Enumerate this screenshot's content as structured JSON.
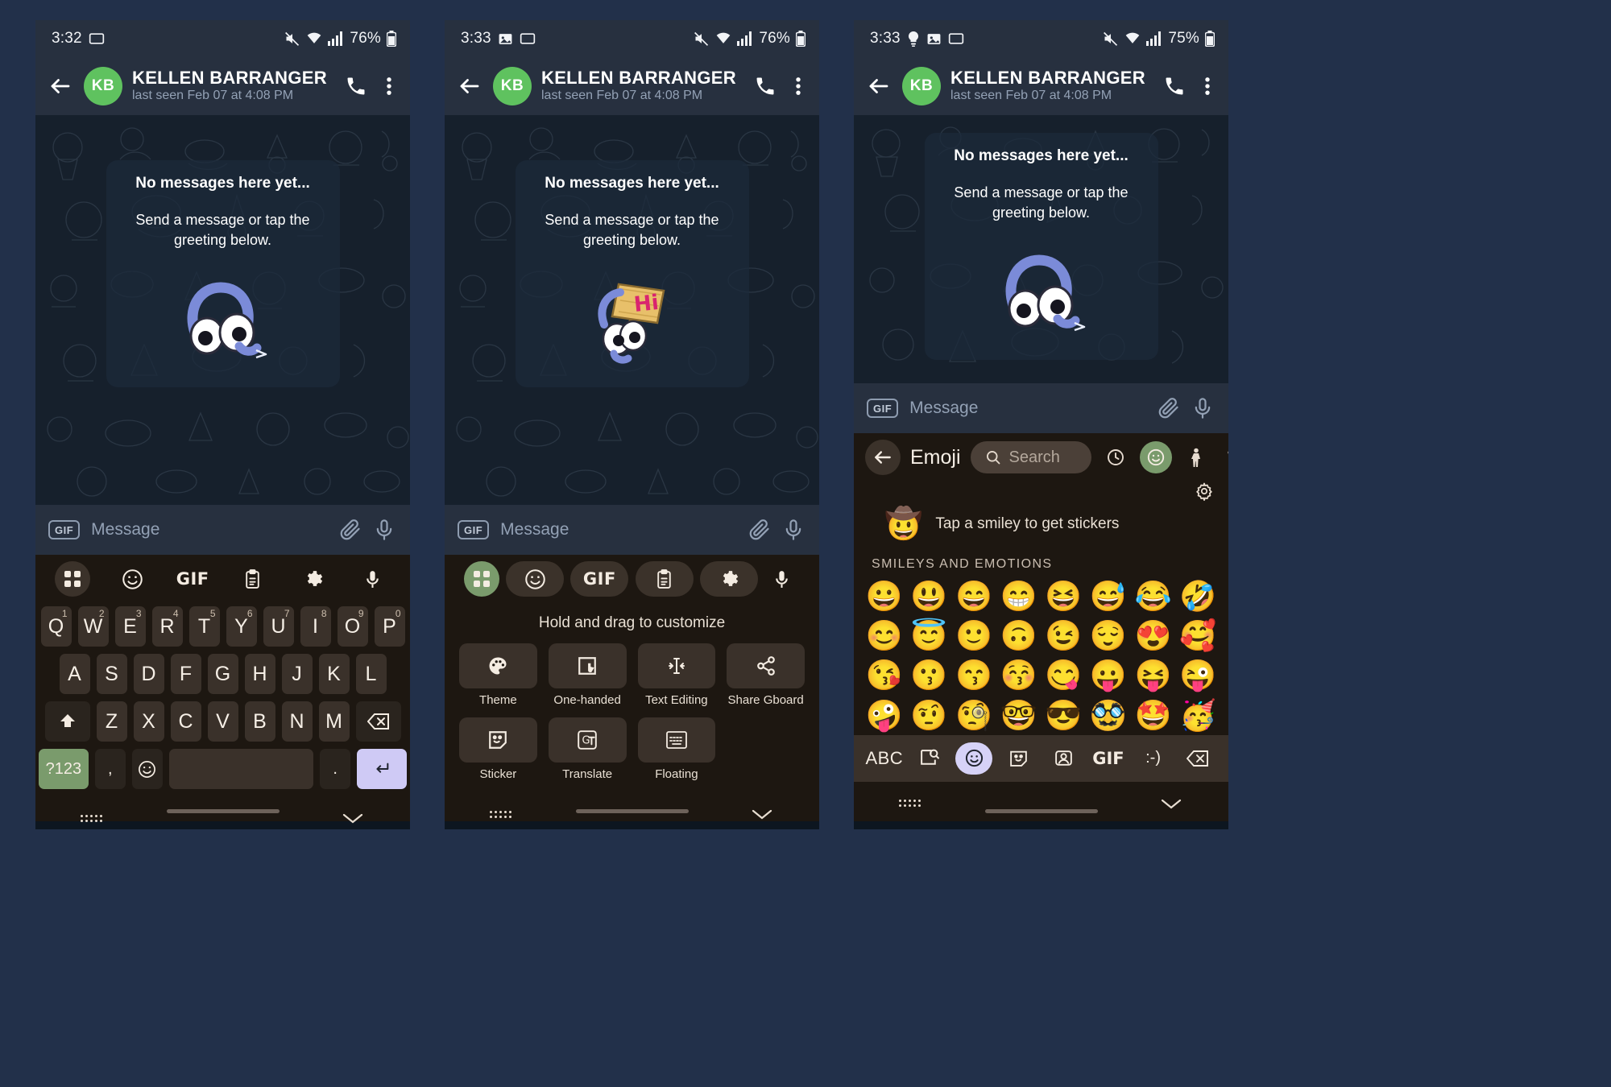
{
  "panels": [
    {
      "id": "panel-keyboard",
      "status": {
        "time": "3:32",
        "battery": "76%",
        "icons_left": [
          "cast-icon"
        ],
        "icons_right": [
          "mute-icon",
          "wifi-icon",
          "signal-icon",
          "battery-icon"
        ]
      },
      "header": {
        "avatar_initials": "KB",
        "name": "KELLEN BARRANGER",
        "subtitle": "last seen Feb 07 at 4:08 PM"
      },
      "chat": {
        "empty_title": "No messages here yet...",
        "empty_sub": "Send a message or tap the greeting below.",
        "sticker": "duck-peeking-sticker"
      },
      "input": {
        "gif_label": "GIF",
        "placeholder": "Message",
        "attach": "paperclip-icon",
        "voice": "microphone-icon"
      },
      "keyboard": {
        "toolbar": [
          {
            "name": "grid-icon",
            "active": true,
            "green": false
          },
          {
            "name": "emoji-icon",
            "active": false,
            "green": false
          },
          {
            "name": "gif-icon",
            "label": "GIF",
            "active": false,
            "green": false
          },
          {
            "name": "clipboard-icon",
            "active": false,
            "green": false
          },
          {
            "name": "gear-icon",
            "active": false,
            "green": false
          },
          {
            "name": "microphone-icon",
            "active": false,
            "green": false
          }
        ],
        "row1": [
          {
            "k": "Q",
            "n": "1"
          },
          {
            "k": "W",
            "n": "2"
          },
          {
            "k": "E",
            "n": "3"
          },
          {
            "k": "R",
            "n": "4"
          },
          {
            "k": "T",
            "n": "5"
          },
          {
            "k": "Y",
            "n": "6"
          },
          {
            "k": "U",
            "n": "7"
          },
          {
            "k": "I",
            "n": "8"
          },
          {
            "k": "O",
            "n": "9"
          },
          {
            "k": "P",
            "n": "0"
          }
        ],
        "row2": [
          "A",
          "S",
          "D",
          "F",
          "G",
          "H",
          "J",
          "K",
          "L"
        ],
        "row3": [
          "Z",
          "X",
          "C",
          "V",
          "B",
          "N",
          "M"
        ],
        "shift_key": "shift-icon",
        "backspace_key": "backspace-icon",
        "sym_key": "?123",
        "comma_key": ",",
        "emoji_key": "emoji-icon",
        "space_key": "",
        "period_key": ".",
        "enter_key": "enter-icon"
      },
      "navbar": {
        "left": "keyboard-dots-icon",
        "right": "chevron-down-icon"
      }
    },
    {
      "id": "panel-customize",
      "status": {
        "time": "3:33",
        "battery": "76%",
        "icons_left": [
          "image-icon",
          "cast-icon"
        ],
        "icons_right": [
          "mute-icon",
          "wifi-icon",
          "signal-icon",
          "battery-icon"
        ]
      },
      "header": {
        "avatar_initials": "KB",
        "name": "KELLEN BARRANGER",
        "subtitle": "last seen Feb 07 at 4:08 PM"
      },
      "chat": {
        "empty_title": "No messages here yet...",
        "empty_sub": "Send a message or tap the greeting below.",
        "sticker": "duck-hi-sign-sticker"
      },
      "input": {
        "gif_label": "GIF",
        "placeholder": "Message",
        "attach": "paperclip-icon",
        "voice": "microphone-icon"
      },
      "keyboard": {
        "toolbar": [
          {
            "name": "grid-icon",
            "active": false,
            "green": true
          },
          {
            "name": "emoji-icon",
            "active": true,
            "green": false
          },
          {
            "name": "gif-icon",
            "label": "GIF",
            "active": true,
            "green": false
          },
          {
            "name": "clipboard-icon",
            "active": true,
            "green": false
          },
          {
            "name": "gear-icon",
            "active": true,
            "green": false
          },
          {
            "name": "microphone-icon",
            "active": false,
            "green": false
          }
        ]
      },
      "customize": {
        "hint": "Hold and drag to customize",
        "items": [
          {
            "label": "Theme",
            "icon": "palette-icon"
          },
          {
            "label": "One-handed",
            "icon": "one-handed-icon"
          },
          {
            "label": "Text Editing",
            "icon": "text-editing-icon"
          },
          {
            "label": "Share Gboard",
            "icon": "share-icon"
          },
          {
            "label": "Sticker",
            "icon": "sticker-icon"
          },
          {
            "label": "Translate",
            "icon": "translate-icon"
          },
          {
            "label": "Floating",
            "icon": "floating-keyboard-icon"
          }
        ]
      },
      "navbar": {
        "left": "keyboard-dots-icon",
        "right": "chevron-down-icon"
      }
    },
    {
      "id": "panel-emoji",
      "status": {
        "time": "3:33",
        "battery": "75%",
        "icons_left": [
          "bulb-icon",
          "image-icon",
          "cast-icon"
        ],
        "icons_right": [
          "mute-icon",
          "wifi-icon",
          "signal-icon",
          "battery-icon"
        ]
      },
      "header": {
        "avatar_initials": "KB",
        "name": "KELLEN BARRANGER",
        "subtitle": "last seen Feb 07 at 4:08 PM"
      },
      "chat": {
        "empty_title": "No messages here yet...",
        "empty_sub": "Send a message or tap the greeting below.",
        "sticker": "duck-peeking-sticker"
      },
      "input": {
        "gif_label": "GIF",
        "placeholder": "Message",
        "attach": "paperclip-icon",
        "voice": "microphone-icon"
      },
      "emoji": {
        "back": "back-arrow-icon",
        "title": "Emoji",
        "search_placeholder": "Search",
        "categories": [
          "recent-clock-icon",
          "smiley-icon",
          "person-icon",
          "animal-icon",
          "food-icon"
        ],
        "selected_category_index": 1,
        "settings_icon": "gear-icon",
        "sticker_hint": "Tap a smiley to get stickers",
        "sticker_hint_face": "🤠",
        "section_header": "SMILEYS AND EMOTIONS",
        "grid": [
          "😀",
          "😃",
          "😄",
          "😁",
          "😆",
          "😅",
          "😂",
          "🤣",
          "😊",
          "😇",
          "🙂",
          "🙃",
          "😉",
          "😌",
          "😍",
          "🥰",
          "😘",
          "😗",
          "😙",
          "😚",
          "😋",
          "😛",
          "😝",
          "😜",
          "🤪",
          "🤨",
          "🧐",
          "🤓",
          "😎",
          "🥸",
          "🤩",
          "🥳"
        ],
        "bottom_bar": {
          "abc": "ABC",
          "buttons": [
            "abc-label",
            "sticker-search-icon",
            "emoji-icon",
            "sticker-icon",
            "avatar-sticker-icon",
            "gif-icon",
            "kaomoji-icon",
            "backspace-icon"
          ],
          "gif_label": "GIF",
          "kaomoji_label": ":-)",
          "selected_index": 2
        }
      },
      "navbar": {
        "left": "keyboard-dots-icon",
        "right": "chevron-down-icon"
      }
    }
  ],
  "theme": {
    "page_bg": "#22304a",
    "telegram_header": "#27303f",
    "chat_bg": "#16202c",
    "keyboard_bg": "#1d1711",
    "key_bg": "#3a312a",
    "accent_green": "#7a9b6c",
    "enter_lavender": "#cfcaf5",
    "avatar_green": "#5fc25f"
  }
}
